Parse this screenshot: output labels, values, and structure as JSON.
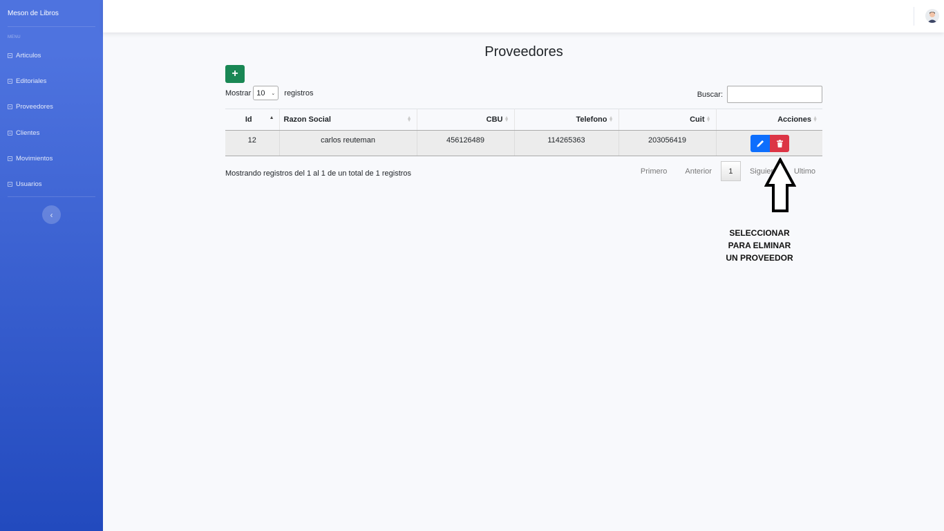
{
  "sidebar": {
    "brand": "Meson de Libros",
    "menu_heading": "MENU",
    "items": [
      {
        "label": "Articulos"
      },
      {
        "label": "Editoriales"
      },
      {
        "label": "Proveedores"
      },
      {
        "label": "Clientes"
      },
      {
        "label": "Movimientos"
      },
      {
        "label": "Usuarios"
      }
    ],
    "toggle_icon": "chevron-left-icon"
  },
  "main": {
    "title": "Proveedores",
    "add_label": "+",
    "length": {
      "prefix": "Mostrar",
      "value": "10",
      "suffix": "registros"
    },
    "search": {
      "label": "Buscar:",
      "value": ""
    },
    "table": {
      "columns": [
        "Id",
        "Razon Social",
        "CBU",
        "Telefono",
        "Cuit",
        "Acciones"
      ],
      "rows": [
        {
          "id": "12",
          "razon_social": "carlos reuteman",
          "cbu": "456126489",
          "telefono": "114265363",
          "cuit": "203056419"
        }
      ]
    },
    "info": "Mostrando registros del 1 al 1 de un total de 1 registros",
    "pagination": {
      "first": "Primero",
      "prev": "Anterior",
      "current": "1",
      "next": "Siguiente",
      "last": "Ultimo"
    },
    "annotation": [
      "SELECCIONAR",
      "PARA ELMINAR",
      "UN PROVEEDOR"
    ]
  },
  "colors": {
    "sidebar_top": "#4e73df",
    "sidebar_bottom": "#224abe",
    "add": "#198754",
    "edit": "#0d6efd",
    "delete": "#dc3545"
  }
}
